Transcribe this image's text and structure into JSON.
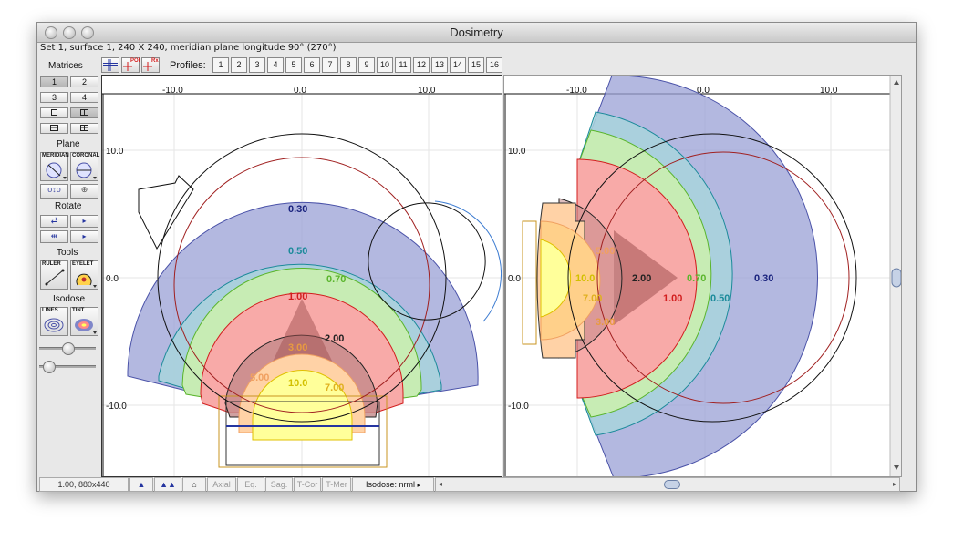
{
  "window": {
    "title": "Dosimetry"
  },
  "info_line": "Set 1, surface 1, 240 X 240, meridian plane longitude 90° (270°)",
  "sidebar": {
    "matrices_label": "Matrices",
    "matrix_buttons": [
      "1",
      "2",
      "3",
      "4"
    ],
    "plane_label": "Plane",
    "meridian_label": "MERIDIAN",
    "coronal_label": "CORONAL",
    "rotate_label": "Rotate",
    "tools_label": "Tools",
    "ruler_label": "RULER",
    "eyelet_label": "EYELET",
    "isodose_label": "Isodose",
    "lines_label": "LINES",
    "tint_label": "TINT"
  },
  "toolbar": {
    "profiles_label": "Profiles:",
    "profile_buttons": [
      "1",
      "2",
      "3",
      "4",
      "5",
      "6",
      "7",
      "8",
      "9",
      "10",
      "11",
      "12",
      "13",
      "14",
      "15",
      "16"
    ],
    "poi_sup": "POI",
    "rx_sup": "Rx"
  },
  "status_bar": {
    "zoom_text": "1.00, 880x440",
    "axial": "Axial",
    "eq": "Eq.",
    "sag": "Sag.",
    "tcor": "T-Cor",
    "tmer": "T-Mer",
    "isodose_mode": "Isodose: nrml"
  },
  "plots": {
    "left": {
      "x_ticks": [
        "-10.0",
        "0.0",
        "10.0"
      ],
      "y_ticks": [
        "10.0",
        "0.0",
        "-10.0"
      ],
      "isodose_labels": [
        "0.30",
        "0.50",
        "0.70",
        "1.00",
        "2.00",
        "3.00",
        "5.00",
        "10.0",
        "7.00"
      ]
    },
    "right": {
      "x_ticks": [
        "-10.0",
        "0.0",
        "10.0"
      ],
      "y_ticks": [
        "10.0",
        "0.0",
        "-10.0"
      ],
      "isodose_labels": [
        "5.00",
        "10.0",
        "2.00",
        "0.70",
        "0.30",
        "7.00",
        "1.00",
        "0.50",
        "3.00"
      ]
    }
  },
  "colors": {
    "level_030": "#4a52a8",
    "level_050": "#1b8a9a",
    "level_070": "#5ab52c",
    "level_100": "#d81e1e",
    "level_200": "#7a1010",
    "level_300": "#e89a40",
    "level_500": "#f0a060",
    "level_700": "#e0b020",
    "level_1000": "#ffff40"
  }
}
